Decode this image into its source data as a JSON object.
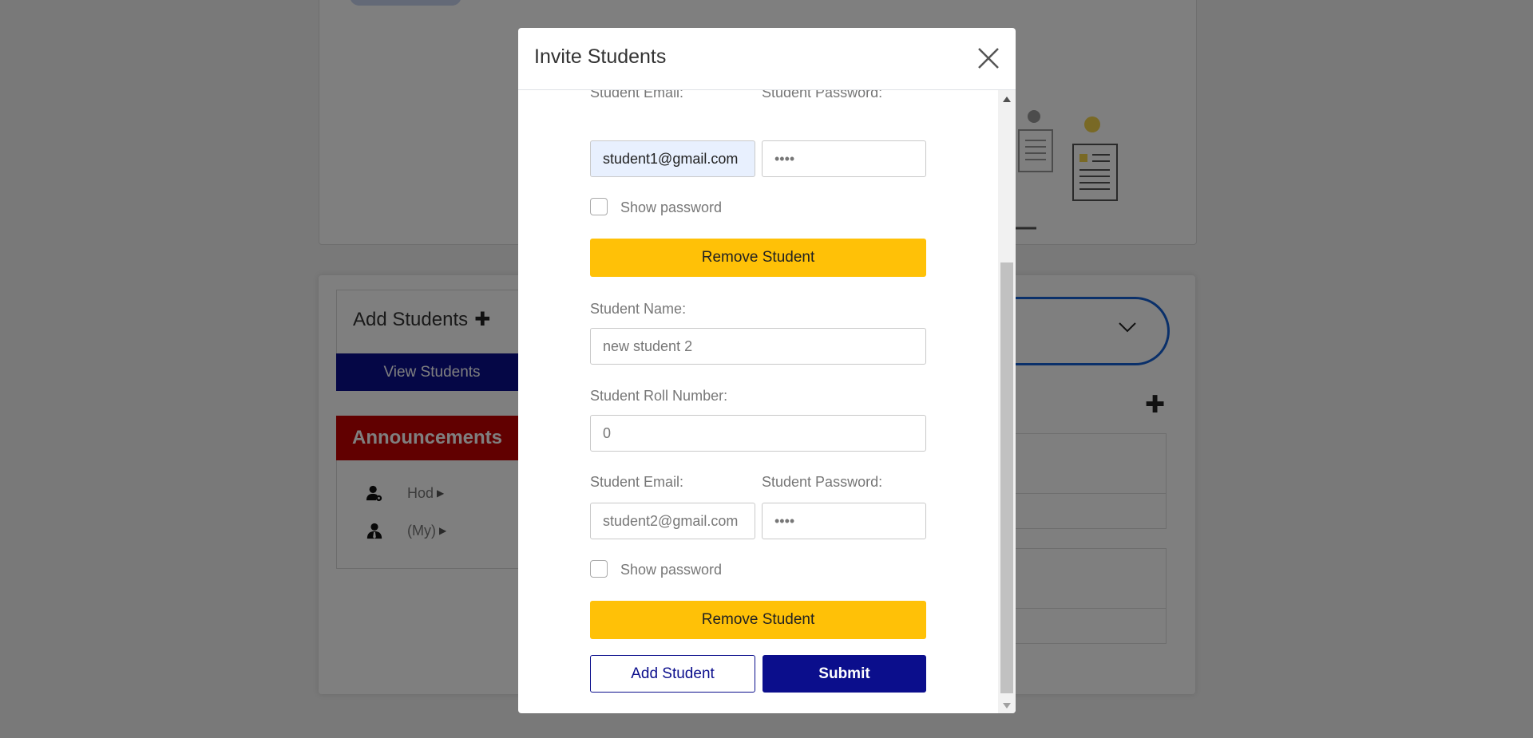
{
  "background": {
    "left_panel": {
      "add_students_label": "Add Students",
      "add_icon": "plus-icon",
      "view_students_label": "View Students"
    },
    "announcements": {
      "title": "Announcements",
      "items": [
        {
          "label": "Hod",
          "icon": "user-gear-icon"
        },
        {
          "label": "(My)",
          "icon": "user-tie-icon"
        }
      ]
    },
    "dropdown_icon": "chevron-down-icon",
    "right_add_icon": "plus-icon"
  },
  "modal": {
    "title": "Invite Students",
    "close_icon": "close-icon",
    "students": [
      {
        "email_label": "Student Email:",
        "email_value": "student1@gmail.com",
        "password_label": "Student Password:",
        "password_value": "••••",
        "show_password_label": "Show password",
        "remove_label": "Remove Student"
      },
      {
        "name_label": "Student Name:",
        "name_value": "new student 2",
        "roll_label": "Student Roll Number:",
        "roll_value": "0",
        "email_label": "Student Email:",
        "email_value": "student2@gmail.com",
        "password_label": "Student Password:",
        "password_value": "••••",
        "show_password_label": "Show password",
        "remove_label": "Remove Student"
      }
    ],
    "add_student_label": "Add Student",
    "submit_label": "Submit"
  },
  "colors": {
    "primary_navy": "#0b0e8c",
    "warning_yellow": "#ffc107",
    "announcement_red": "#c30000",
    "autofill_blue": "#e8f0fe"
  }
}
